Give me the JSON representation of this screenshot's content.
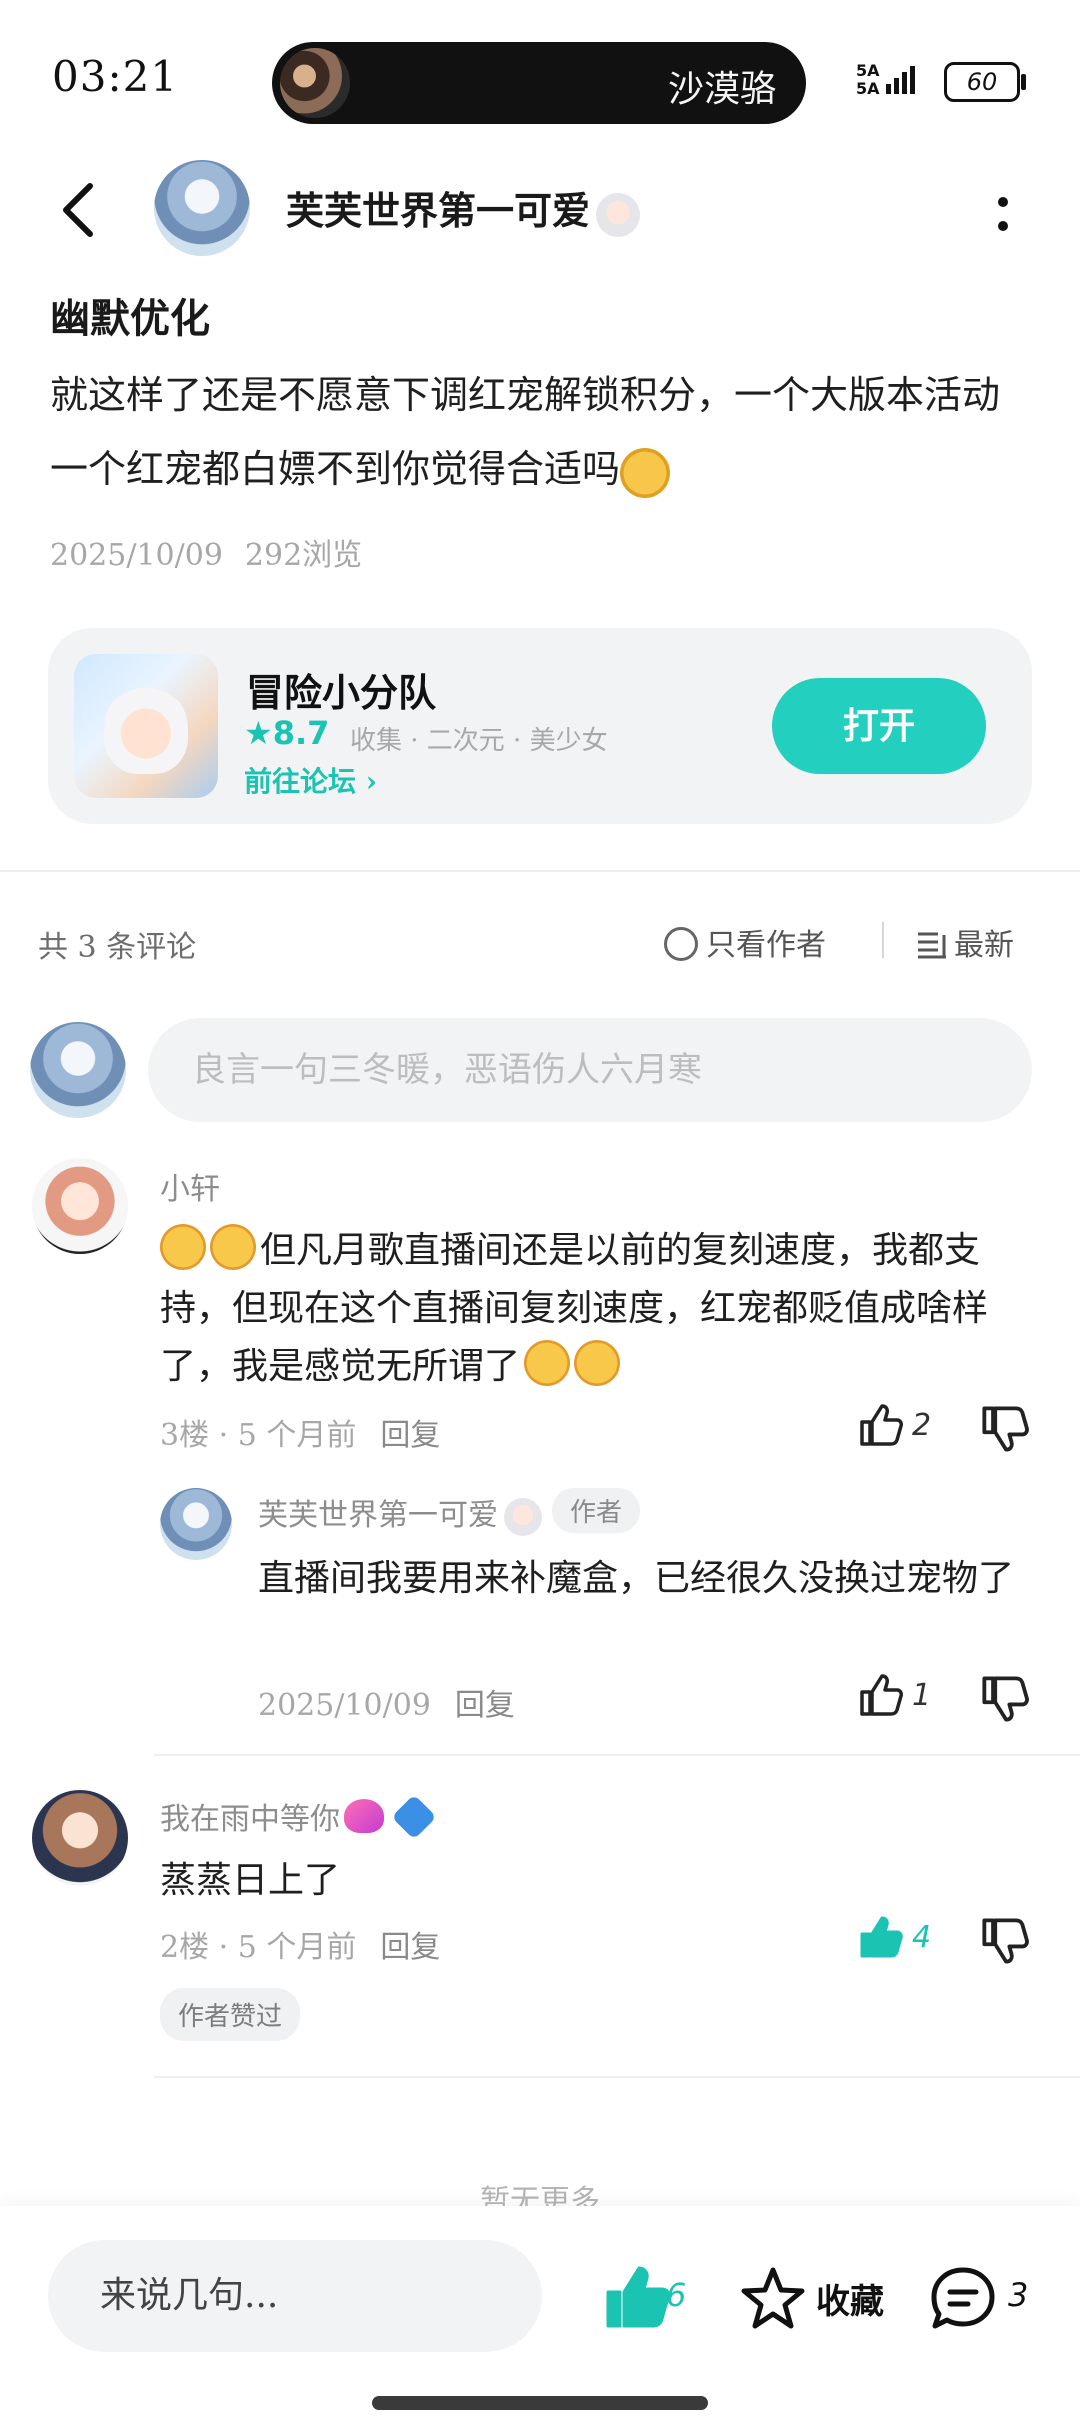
{
  "status_bar": {
    "time": "03:21",
    "now_playing": "沙漠骆",
    "network_label": "5A\n5A",
    "battery": "60"
  },
  "header": {
    "author_name": "芙芙世界第一可爱"
  },
  "post": {
    "title": "幽默优化",
    "body": "就这样了还是不愿意下调红宠解锁积分，一个大版本活动一个红宠都白嫖不到你觉得合适吗",
    "date": "2025/10/09",
    "views": "292浏览"
  },
  "game_card": {
    "name": "冒险小分队",
    "rating": "★8.7",
    "tags": "收集 · 二次元 · 美少女",
    "forum_link": "前往论坛 ›",
    "open_label": "打开"
  },
  "comments_header": {
    "count_label": "共 3 条评论",
    "author_only_label": "只看作者",
    "sort_label": "最新"
  },
  "comment_input": {
    "placeholder": "良言一句三冬暖，恶语伤人六月寒"
  },
  "comments": [
    {
      "name": "小轩",
      "text": "但凡月歌直播间还是以前的复刻速度，我都支持，但现在这个直播间复刻速度，红宠都贬值成啥样了，我是感觉无所谓了",
      "floor_time": "3楼 · 5 个月前",
      "reply_label": "回复",
      "likes": "2",
      "reply": {
        "name": "芙芙世界第一可爱",
        "tag": "作者",
        "text": "直播间我要用来补魔盒，已经很久没换过宠物了",
        "time": "2025/10/09",
        "reply_label": "回复",
        "likes": "1"
      }
    },
    {
      "name": "我在雨中等你",
      "text": "蒸蒸日上了",
      "floor_time": "2楼 · 5 个月前",
      "reply_label": "回复",
      "likes": "4",
      "liked_tag": "作者赞过"
    }
  ],
  "no_more": "暂无更多",
  "bottom_bar": {
    "input_label": "来说几句...",
    "like_count": "6",
    "favorite_label": "收藏",
    "comment_count": "3"
  },
  "colors": {
    "accent": "#23cfbe",
    "accent_text": "#1bc3b2",
    "muted": "#a7a7a7",
    "card_bg": "#f2f3f5"
  },
  "icons": [
    "back-icon",
    "more-icon",
    "star-icon",
    "chevron-right-icon",
    "radio-circle-icon",
    "sort-list-icon",
    "thumbs-up-icon",
    "thumbs-down-icon",
    "favorite-star-icon",
    "comment-bubble-icon"
  ]
}
